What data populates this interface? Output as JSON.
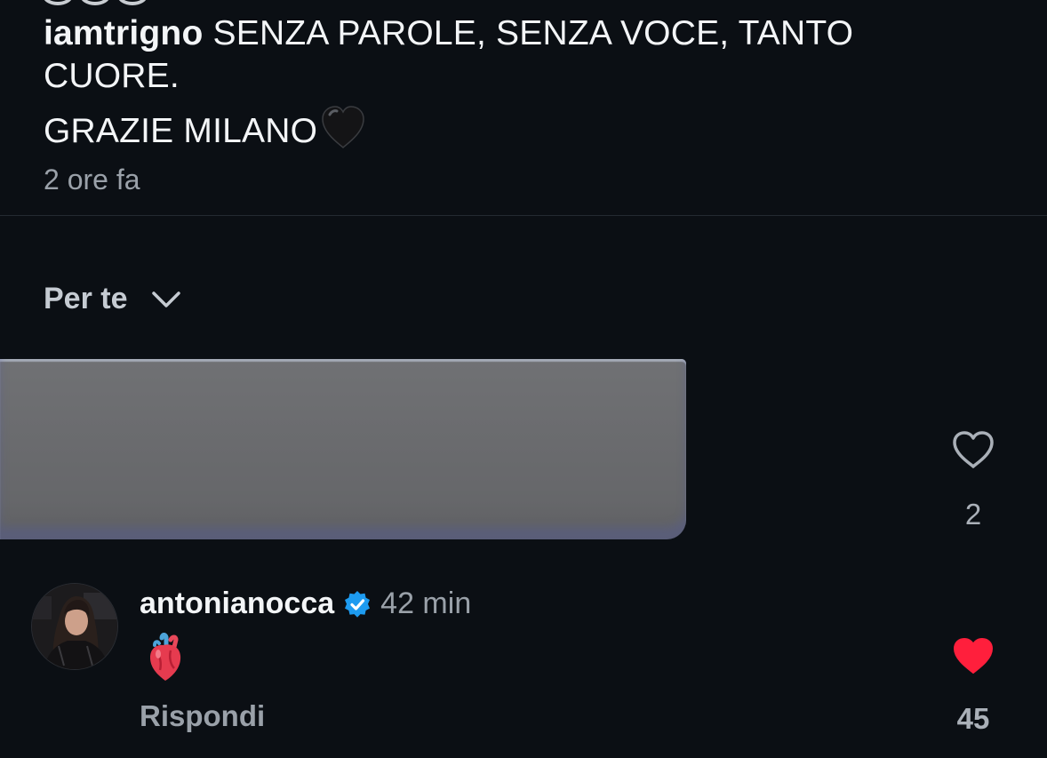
{
  "post": {
    "username": "iamtrigno",
    "caption_line1": "SENZA PAROLE, SENZA VOCE, TANTO CUORE.",
    "caption_line2": "GRAZIE MILANO",
    "caption_emoji_icon": "black-heart-icon",
    "time_ago": "2 ore fa"
  },
  "filter": {
    "label": "Per te",
    "icon": "chevron-down-icon"
  },
  "comments": [
    {
      "content": "redacted",
      "like_icon": "heart-outline-icon",
      "likes": "2",
      "liked": false
    },
    {
      "username": "antonianocca",
      "verified": true,
      "time": "42 min",
      "content_emoji": "anatomical-heart-icon",
      "reply_label": "Rispondi",
      "like_icon": "heart-filled-icon",
      "likes": "45",
      "liked": true
    }
  ],
  "colors": {
    "background": "#0b0f14",
    "text_primary": "#f3f5f7",
    "text_secondary": "#9aa1a9",
    "liked_heart": "#ff1f3c",
    "verified_badge": "#1d9bf0"
  }
}
